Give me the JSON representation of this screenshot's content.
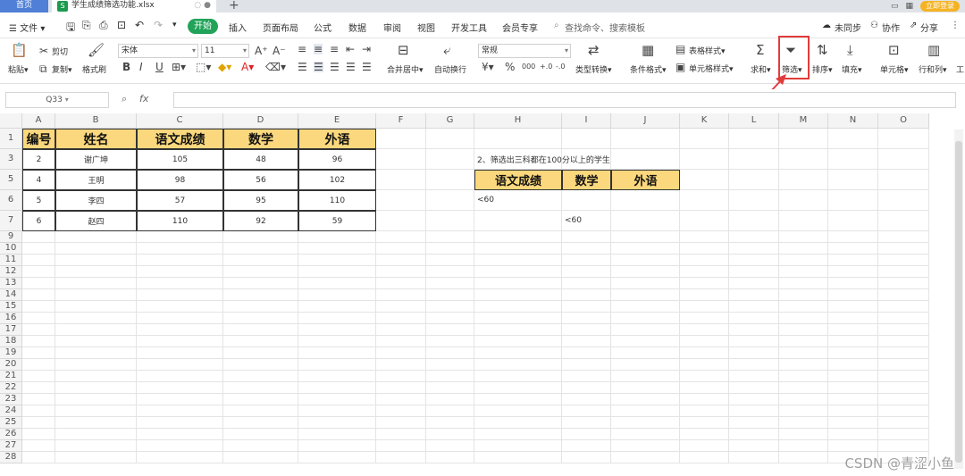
{
  "titlebar": {
    "home_tab": "首页",
    "file_tab": "学生成绩筛选功能.xlsx",
    "file_icon": "S",
    "tab_extra": "◌ ●",
    "new_tab": "+",
    "login": "立即登录"
  },
  "menu": {
    "file": "☰ 文件 ▾",
    "active": "开始",
    "items": [
      "插入",
      "页面布局",
      "公式",
      "数据",
      "审阅",
      "视图",
      "开发工具",
      "会员专享"
    ],
    "search": "查找命令、搜索模板",
    "right": [
      "未同步",
      "协作",
      "分享"
    ]
  },
  "ribbon": {
    "paste": "粘贴▾",
    "cut": "剪切",
    "copy": "复制▾",
    "format_painter": "格式刷",
    "font_name": "宋体",
    "font_size": "11",
    "merge": "合并居中▾",
    "wrap": "自动换行",
    "number_format": "常规",
    "type_convert": "类型转换▾",
    "cond_format": "条件格式▾",
    "table_style": "表格样式▾",
    "cell_style": "单元格样式▾",
    "sum": "求和▾",
    "filter": "筛选▾",
    "sort": "排序▾",
    "fill": "填充▾",
    "cell": "单元格▾",
    "row_col": "行和列▾",
    "work": "工"
  },
  "formula_bar": {
    "name_box": "Q33",
    "fx": "fx",
    "formula": ""
  },
  "columns": [
    "A",
    "B",
    "C",
    "D",
    "E",
    "F",
    "G",
    "H",
    "I",
    "J",
    "K",
    "L",
    "M",
    "N",
    "O"
  ],
  "rows": [
    "1",
    "3",
    "5",
    "6",
    "7",
    "9",
    "10",
    "11",
    "12",
    "13",
    "14",
    "15",
    "16",
    "17",
    "18",
    "19",
    "20",
    "21",
    "22",
    "23",
    "24",
    "25",
    "26",
    "27",
    "28"
  ],
  "table": {
    "headers": [
      "编号",
      "姓名",
      "语文成绩",
      "数学",
      "外语"
    ],
    "rows": [
      [
        "2",
        "谢广坤",
        "105",
        "48",
        "96"
      ],
      [
        "4",
        "王明",
        "98",
        "56",
        "102"
      ],
      [
        "5",
        "李四",
        "57",
        "95",
        "110"
      ],
      [
        "6",
        "赵四",
        "110",
        "92",
        "59"
      ]
    ]
  },
  "criteria": {
    "title": "2、筛选出三科都在100分以上的学生",
    "headers": [
      "语文成绩",
      "数学",
      "外语"
    ],
    "row1": "<60",
    "row2": "<60"
  },
  "watermark": "CSDN @青涩小鱼"
}
